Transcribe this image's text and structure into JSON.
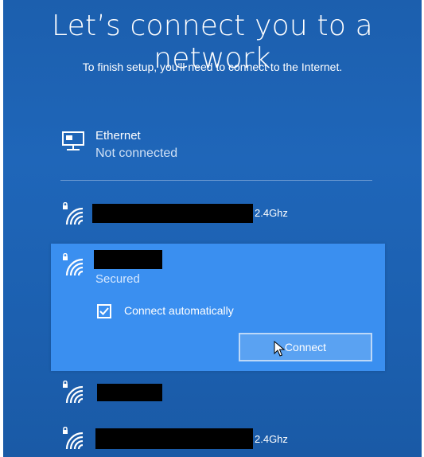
{
  "header": {
    "title": "Let’s connect you to a network",
    "subtitle": "To finish setup, you'll need to connect to the Internet."
  },
  "ethernet": {
    "name": "Ethernet",
    "status": "Not connected",
    "icon": "ethernet-icon"
  },
  "networks": [
    {
      "band": "2.4Ghz",
      "icon": "wifi-secured-icon"
    },
    {
      "band": "",
      "status": "Secured",
      "icon": "wifi-secured-icon",
      "selected": true
    },
    {
      "band": "",
      "icon": "wifi-secured-icon"
    },
    {
      "band": "2.4Ghz",
      "icon": "wifi-secured-icon"
    }
  ],
  "selected": {
    "status": "Secured",
    "connect_auto_label": "Connect automatically",
    "connect_auto_checked": true,
    "connect_button": "Connect"
  },
  "colors": {
    "background": "#1f66b9",
    "selected_panel": "#3a8ff0",
    "text": "#ffffff"
  }
}
